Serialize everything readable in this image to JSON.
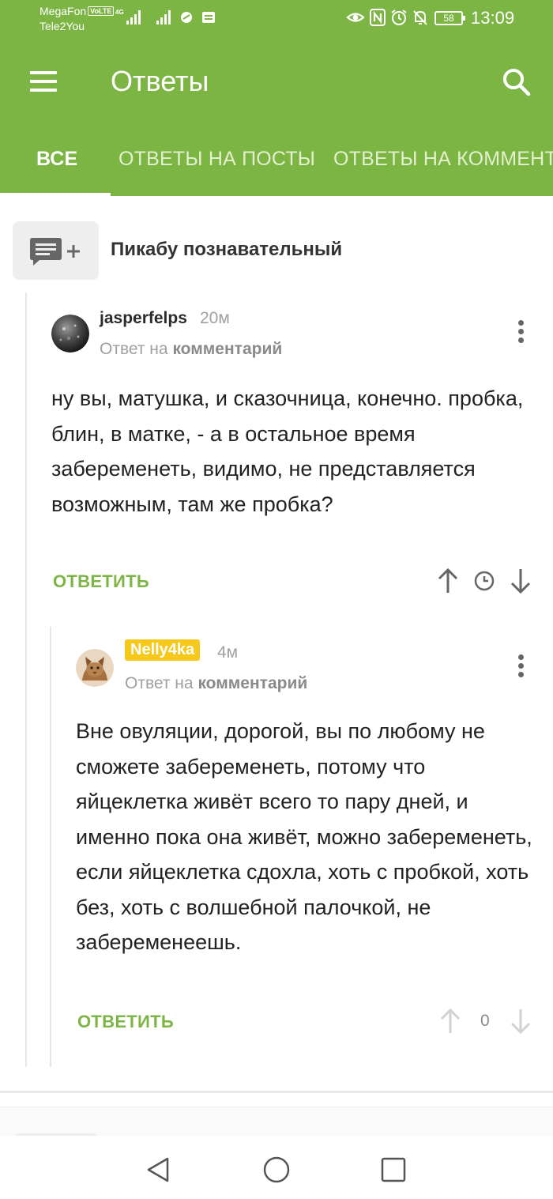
{
  "status_bar": {
    "carrier_1": "MegaFon",
    "volte": "VoLTE",
    "network": "4G",
    "carrier_2": "Tele2You",
    "battery": "58",
    "time": "13:09"
  },
  "app_bar": {
    "title": "Ответы",
    "menu_icon": "hamburger-menu-icon",
    "search_icon": "search-icon"
  },
  "tabs": [
    {
      "label": "ВСЕ",
      "active": true
    },
    {
      "label": "ОТВЕТЫ НА ПОСТЫ",
      "active": false
    },
    {
      "label": "ОТВЕТЫ НА КОММЕНТАРИИ",
      "active": false
    }
  ],
  "post": {
    "title": "Пикабу познавательный",
    "icon": "add-comment-icon"
  },
  "comments": [
    {
      "author": "jasperfelps",
      "age": "20м",
      "reply_prefix": "Ответ на",
      "reply_target": "комментарий",
      "text": "ну вы, матушка, и сказочница, конечно. пробка, блин, в матке, - а в остальное время забеременеть, видимо, не представляется возможным, там же пробка?",
      "reply_label": "ОТВЕТИТЬ"
    },
    {
      "author": "Nelly4ka",
      "age": "4м",
      "reply_prefix": "Ответ на",
      "reply_target": "комментарий",
      "text": "Вне овуляции, дорогой, вы по любому не сможете забеременеть, потому что яйцеклетка живёт всего то пару дней, и именно пока она живёт, можно забеременеть, если яйцеклетка сдохла, хоть с пробкой, хоть без, хоть с волшебной палочкой, не забеременеешь.",
      "reply_label": "ОТВЕТИТЬ",
      "rating": "0"
    }
  ],
  "colors": {
    "accent": "#7db544",
    "badge": "#f6c81a"
  }
}
